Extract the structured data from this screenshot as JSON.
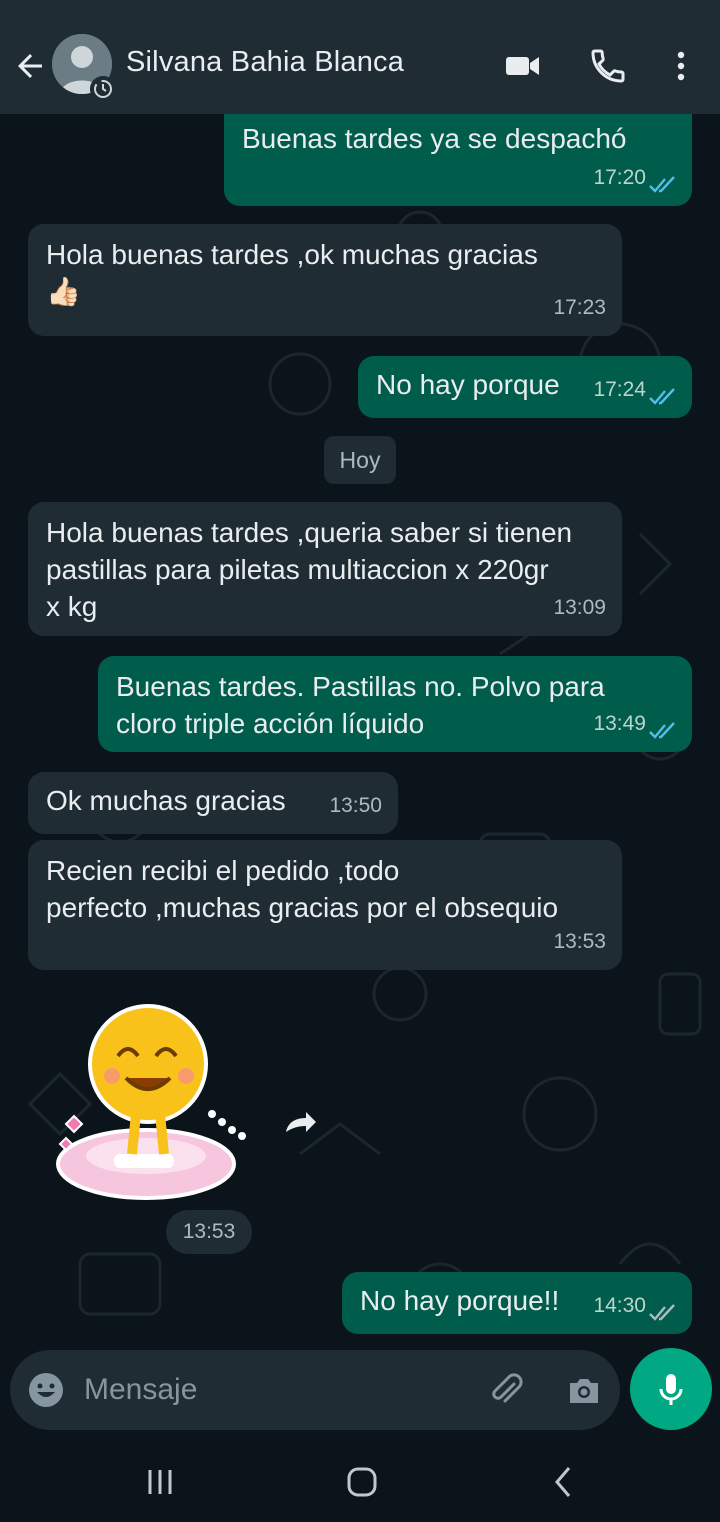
{
  "header": {
    "contact_name": "Silvana Bahia Blanca",
    "icons": [
      "back-arrow-icon",
      "avatar-icon",
      "video-call-icon",
      "phone-icon",
      "more-vert-icon"
    ]
  },
  "messages": [
    {
      "dir": "out",
      "text": "Buenas tardes ya se despachó",
      "time": "17:20",
      "status": "read"
    },
    {
      "dir": "in",
      "text": "Hola buenas tardes ,ok muchas gracias\n👍🏻",
      "time": "17:23"
    },
    {
      "dir": "out",
      "text": "No hay porque",
      "time": "17:24",
      "status": "read"
    },
    {
      "dir": "in",
      "text": "Hola buenas tardes ,queria saber si tienen\npastillas para piletas multiaccion x 220gr\nx kg",
      "time": "13:09"
    },
    {
      "dir": "out",
      "text": "Buenas tardes. Pastillas no. Polvo para\ncloro triple acción líquido",
      "time": "13:49",
      "status": "read"
    },
    {
      "dir": "in",
      "text": "Ok muchas gracias",
      "time": "13:50"
    },
    {
      "dir": "in",
      "text": "Recien recibi el pedido ,todo\nperfecto ,muchas gracias por el obsequio",
      "time": "13:53"
    },
    {
      "dir": "in",
      "type": "sticker",
      "time": "13:53"
    },
    {
      "dir": "out",
      "text": "No hay porque!!",
      "time": "14:30",
      "status": "delivered"
    }
  ],
  "day_divider": "Hoy",
  "input": {
    "placeholder": "Mensaje"
  },
  "colors": {
    "background": "#0b141a",
    "header": "#1f2c34",
    "incoming_bubble": "#1f2c34",
    "outgoing_bubble": "#005c4b",
    "accent": "#00a884",
    "read_ticks": "#53bdeb"
  }
}
